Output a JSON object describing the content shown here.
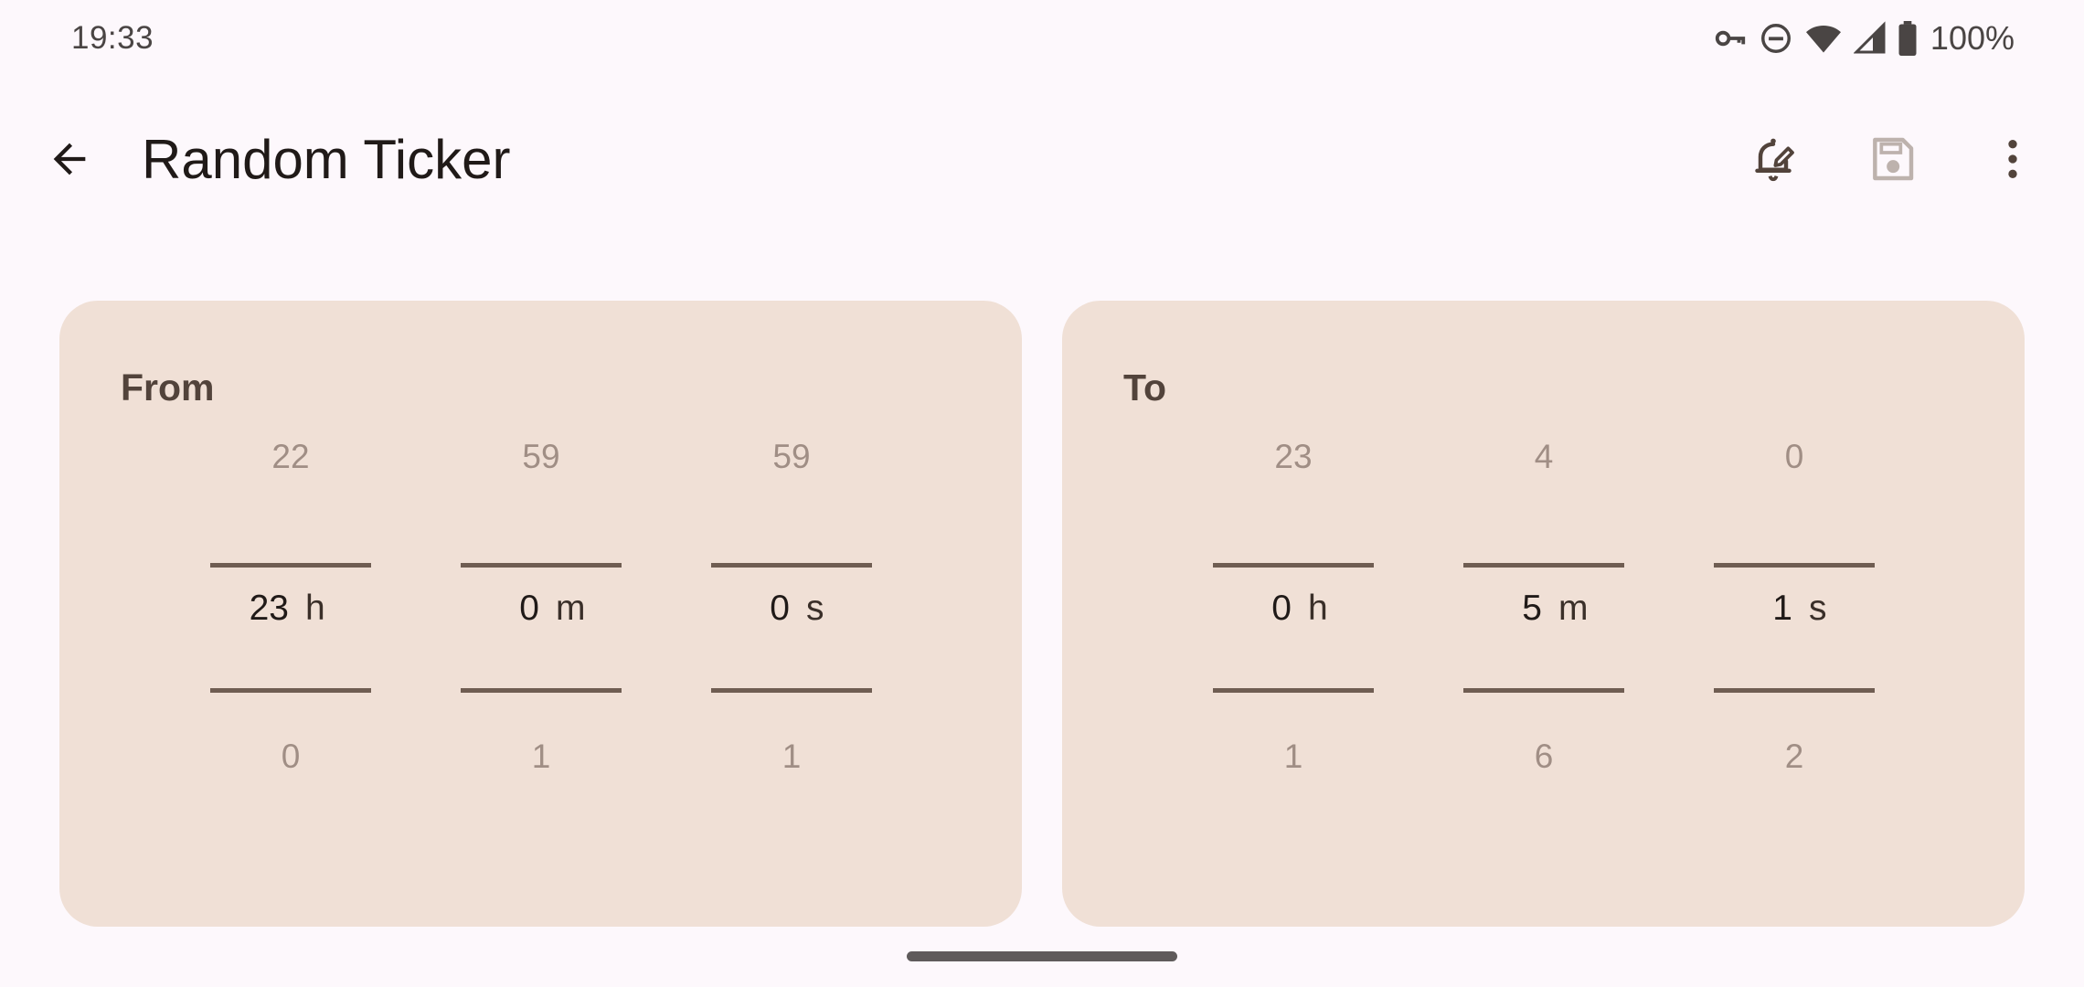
{
  "status_bar": {
    "time": "19:33",
    "icons": [
      "vpn-key-icon",
      "do-not-disturb-icon",
      "wifi-icon",
      "cell-signal-icon",
      "battery-icon"
    ],
    "battery": "100%"
  },
  "app_bar": {
    "title": "Random Ticker",
    "actions": [
      "alarm-edit-icon",
      "save-icon",
      "more-vert-icon"
    ]
  },
  "from": {
    "label": "From",
    "hours": {
      "prev": "22",
      "value": "23",
      "unit": "h",
      "next": "0"
    },
    "minutes": {
      "prev": "59",
      "value": "0",
      "unit": "m",
      "next": "1"
    },
    "seconds": {
      "prev": "59",
      "value": "0",
      "unit": "s",
      "next": "1"
    }
  },
  "to": {
    "label": "To",
    "hours": {
      "prev": "23",
      "value": "0",
      "unit": "h",
      "next": "1"
    },
    "minutes": {
      "prev": "4",
      "value": "5",
      "unit": "m",
      "next": "6"
    },
    "seconds": {
      "prev": "0",
      "value": "1",
      "unit": "s",
      "next": "2"
    }
  },
  "colors": {
    "background": "#fdf8fc",
    "card": "#f0e0d6",
    "label": "#52433b",
    "divider": "#6f5d52"
  }
}
